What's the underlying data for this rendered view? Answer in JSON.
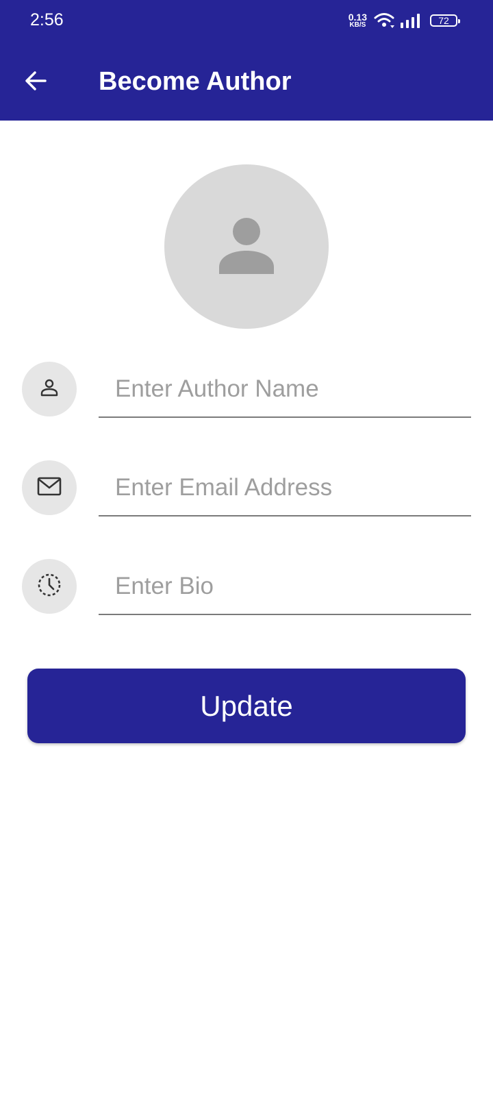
{
  "status_bar": {
    "time": "2:56",
    "net_speed_value": "0.13",
    "net_speed_unit": "KB/S",
    "battery_level": "72"
  },
  "app_bar": {
    "title": "Become Author",
    "back_icon": "arrow-left-icon"
  },
  "avatar": {
    "icon": "person-placeholder-icon"
  },
  "form": {
    "fields": [
      {
        "icon": "person-icon",
        "placeholder": "Enter Author Name",
        "value": ""
      },
      {
        "icon": "mail-icon",
        "placeholder": "Enter Email Address",
        "value": ""
      },
      {
        "icon": "dashed-clock-icon",
        "placeholder": "Enter Bio",
        "value": ""
      }
    ],
    "submit_label": "Update"
  },
  "colors": {
    "primary": "#262496",
    "avatar_bg": "#d9d9d9",
    "icon_bg": "#e6e6e6",
    "placeholder": "#9e9e9e"
  }
}
